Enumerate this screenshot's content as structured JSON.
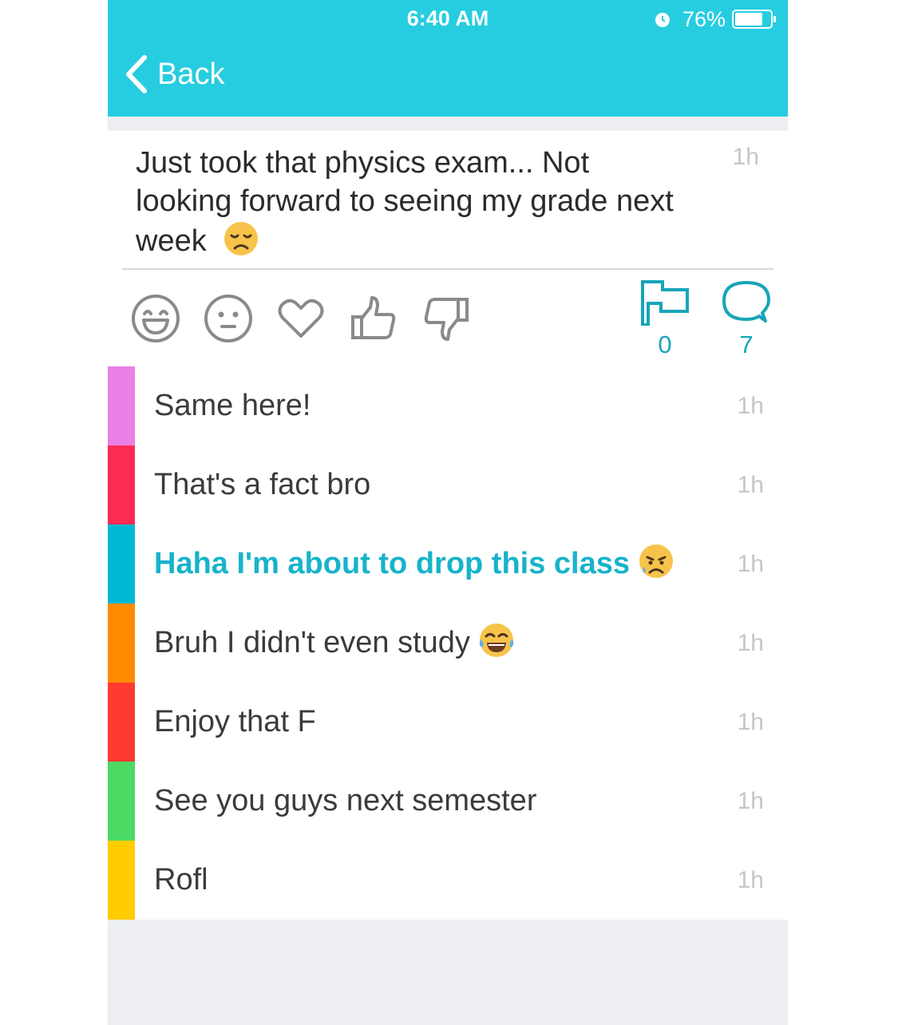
{
  "status_bar": {
    "time": "6:40 AM",
    "battery": "76%"
  },
  "nav": {
    "back_label": "Back"
  },
  "post": {
    "text": "Just took that physics exam... Not looking forward to seeing my grade next week",
    "time": "1h",
    "flag_count": "0",
    "comment_count": "7"
  },
  "comments": [
    {
      "text": "Same here!",
      "time": "1h",
      "color": "#ea80e6"
    },
    {
      "text": "That's a fact bro",
      "time": "1h",
      "color": "#fe2c55"
    },
    {
      "text": "Haha I'm about to drop this class",
      "time": "1h",
      "color": "#00b8d4"
    },
    {
      "text": "Bruh I didn't even study",
      "time": "1h",
      "color": "#ff8c00"
    },
    {
      "text": "Enjoy that F",
      "time": "1h",
      "color": "#ff3b30"
    },
    {
      "text": "See you guys next semester",
      "time": "1h",
      "color": "#4cd964"
    },
    {
      "text": "Rofl",
      "time": "1h",
      "color": "#ffcc00"
    }
  ],
  "colors": {
    "accent": "#26cde0",
    "highlight_text": "#17b3ca",
    "stat": "#17a5b8"
  }
}
